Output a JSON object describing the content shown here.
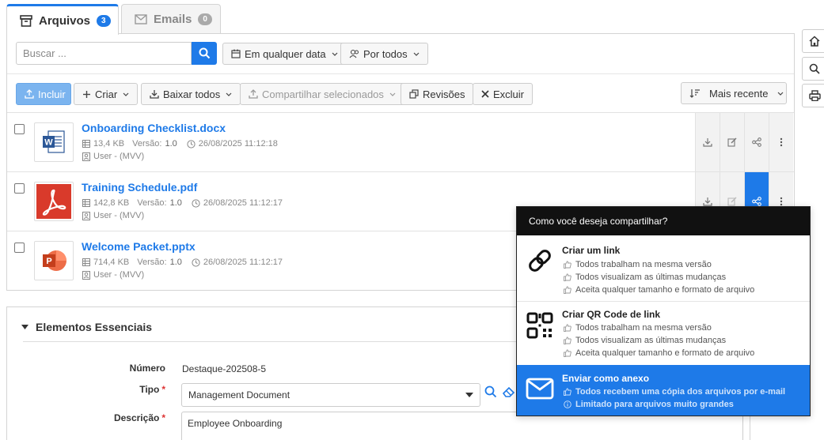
{
  "tabs": [
    {
      "label": "Arquivos",
      "count": "3"
    },
    {
      "label": "Emails",
      "count": "0"
    }
  ],
  "toolbar": {
    "search_placeholder": "Buscar ...",
    "date_filter": "Em qualquer data",
    "user_filter": "Por todos",
    "include": "Incluir",
    "create": "Criar",
    "download_all": "Baixar todos",
    "share_selected": "Compartilhar selecionados",
    "revisions": "Revisões",
    "delete": "Excluir",
    "sort": "Mais recente"
  },
  "files": [
    {
      "name": "Onboarding Checklist.docx",
      "size": "13,4 KB",
      "version_label": "Versão:",
      "version": "1.0",
      "date": "26/08/2025 11:12:18",
      "owner": "User - (MVV)",
      "icon": "word-icon"
    },
    {
      "name": "Training Schedule.pdf",
      "size": "142,8 KB",
      "version_label": "Versão:",
      "version": "1.0",
      "date": "26/08/2025 11:12:17",
      "owner": "User - (MVV)",
      "icon": "pdf-icon"
    },
    {
      "name": "Welcome Packet.pptx",
      "size": "714,4 KB",
      "version_label": "Versão:",
      "version": "1.0",
      "date": "26/08/2025 11:12:17",
      "owner": "User - (MVV)",
      "icon": "powerpoint-icon"
    }
  ],
  "share_popover": {
    "title": "Como você deseja compartilhar?",
    "options": [
      {
        "title": "Criar um link",
        "lines": [
          "Todos trabalham na mesma versão",
          "Todos visualizam as últimas mudanças",
          "Aceita qualquer tamanho e formato de arquivo"
        ]
      },
      {
        "title": "Criar QR Code de link",
        "lines": [
          "Todos trabalham na mesma versão",
          "Todos visualizam as últimas mudanças",
          "Aceita qualquer tamanho e formato de arquivo"
        ]
      },
      {
        "title": "Enviar como anexo",
        "lines": [
          "Todos recebem uma cópia dos arquivos por e-mail",
          "Limitado para arquivos muito grandes"
        ]
      }
    ]
  },
  "essentials": {
    "title": "Elementos Essenciais",
    "number_label": "Número",
    "number_value": "Destaque-202508-5",
    "type_label": "Tipo",
    "type_value": "Management Document",
    "description_label": "Descrição",
    "description_value": "Employee Onboarding",
    "required_mark": "*"
  },
  "colors": {
    "accent": "#1e7ae8",
    "header_dark": "#111111"
  }
}
